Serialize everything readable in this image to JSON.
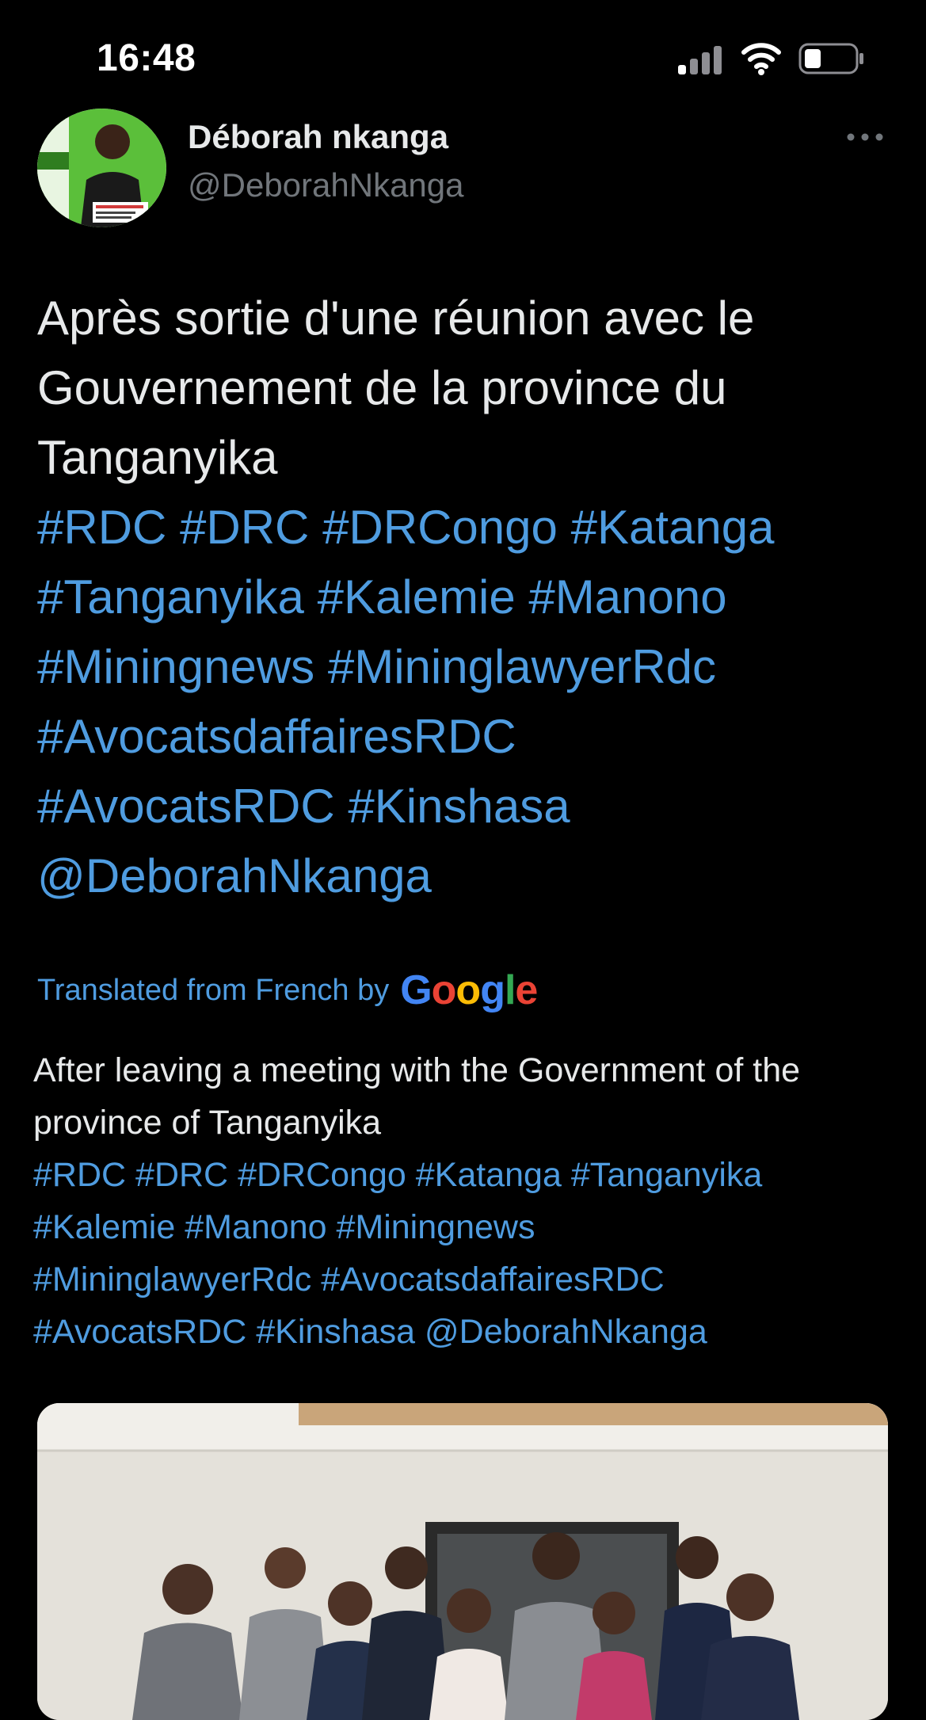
{
  "status": {
    "time": "16:48"
  },
  "tweet": {
    "author": {
      "display_name": "Déborah nkanga",
      "handle": "@DeborahNkanga"
    },
    "text_plain": "Après sortie d'une réunion avec le Gouvernement de la province du Tanganyika",
    "text_tags": [
      "#RDC",
      "#DRC",
      "#DRCongo",
      "#Katanga",
      "#Tanganyika",
      "#Kalemie",
      "#Manono",
      "#Miningnews",
      "#MininglawyerRdc",
      "#AvocatsdaffairesRDC",
      "#AvocatsRDC",
      "#Kinshasa",
      "@DeborahNkanga"
    ],
    "translated_label": "Translated from French by",
    "translator_logo": "Google",
    "translation_plain": "After leaving a meeting with the Government of the province of Tanganyika",
    "translation_tags": [
      "#RDC",
      "#DRC",
      "#DRCongo",
      "#Katanga",
      "#Tanganyika",
      "#Kalemie",
      "#Manono",
      "#Miningnews",
      "#MininglawyerRdc",
      "#AvocatsdaffairesRDC",
      "#AvocatsRDC",
      "#Kinshasa",
      "@DeborahNkanga"
    ]
  },
  "icons": {
    "more": "more-horizontal-icon",
    "signal": "cellular-signal-icon",
    "wifi": "wifi-icon",
    "battery": "battery-icon"
  },
  "colors": {
    "background": "#000000",
    "link": "#4f9ce0",
    "secondary_text": "#71767b"
  }
}
